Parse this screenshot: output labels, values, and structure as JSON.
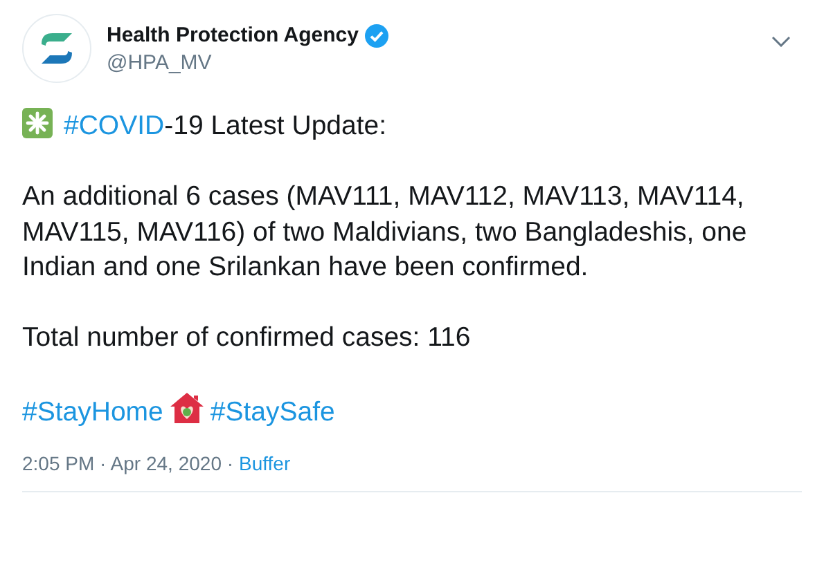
{
  "author": {
    "name": "Health Protection Agency",
    "verified": true,
    "handle": "@HPA_MV"
  },
  "paragraphs": [
    [
      {
        "kind": "emoji"
      },
      {
        "kind": "hashtag",
        "text": "#COVID"
      },
      {
        "kind": "text",
        "text": "-19 Latest Update:"
      }
    ],
    [
      {
        "kind": "text",
        "text": "An additional 6 cases (MAV111, MAV112, MAV113, MAV114, MAV115, MAV116) of two Maldivians, two Bangladeshis, one Indian and one Srilankan have been confirmed."
      }
    ],
    [
      {
        "kind": "text",
        "text": "Total number of confirmed cases: 116"
      }
    ],
    [
      {
        "kind": "hashtag",
        "text": "#StayHome"
      },
      {
        "kind": "house"
      },
      {
        "kind": "hashtag",
        "text": "#StaySafe"
      }
    ]
  ],
  "meta": {
    "timestamp": "2:05 PM · Apr 24, 2020 ·",
    "source": "Buffer"
  }
}
